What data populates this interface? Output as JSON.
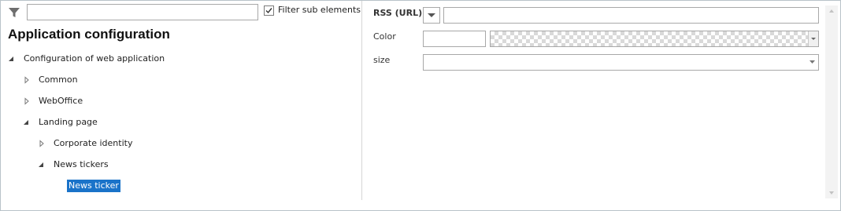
{
  "filter": {
    "input_value": "",
    "checkbox_checked": true,
    "label": "Filter sub elements",
    "icon": "filter-icon"
  },
  "app_title": "Application configuration",
  "tree": [
    {
      "label": "Configuration of web application",
      "expanded": true,
      "has_children": true
    },
    {
      "label": "Common",
      "expanded": false,
      "has_children": true
    },
    {
      "label": "WebOffice",
      "expanded": false,
      "has_children": true
    },
    {
      "label": "Landing page",
      "expanded": true,
      "has_children": true
    },
    {
      "label": "Corporate identity",
      "expanded": false,
      "has_children": true
    },
    {
      "label": "News tickers",
      "expanded": true,
      "has_children": true
    },
    {
      "label": "News ticker",
      "selected": true,
      "has_children": false
    }
  ],
  "properties": {
    "rss_label": "RSS (URL)",
    "rss_value": "",
    "color_label": "Color",
    "color_value": "",
    "size_label": "size",
    "size_value": ""
  },
  "colors": {
    "selection": "#1a73c9",
    "border": "#a8a8a8"
  }
}
